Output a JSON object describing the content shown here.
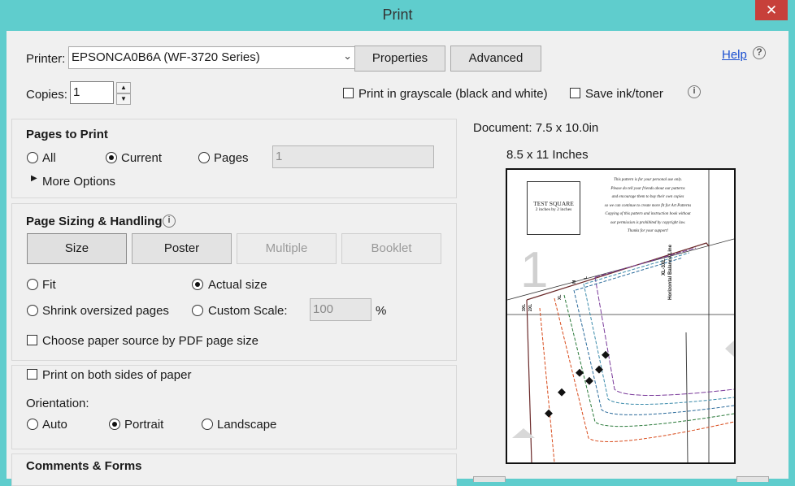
{
  "window": {
    "title": "Print",
    "close_glyph": "✕"
  },
  "printer": {
    "label": "Printer:",
    "selected": "EPSONCA0B6A (WF-3720 Series)",
    "properties_label": "Properties",
    "advanced_label": "Advanced",
    "help_label": "Help"
  },
  "copies": {
    "label": "Copies:",
    "value": "1",
    "grayscale_label": "Print in grayscale (black and white)",
    "save_ink_label": "Save ink/toner"
  },
  "pages_to_print": {
    "title": "Pages to Print",
    "all_label": "All",
    "current_label": "Current",
    "pages_label": "Pages",
    "pages_value": "1",
    "more_options_label": "More Options"
  },
  "page_sizing": {
    "title": "Page Sizing & Handling",
    "size_label": "Size",
    "poster_label": "Poster",
    "multiple_label": "Multiple",
    "booklet_label": "Booklet",
    "fit_label": "Fit",
    "actual_label": "Actual size",
    "shrink_label": "Shrink oversized pages",
    "custom_label": "Custom Scale:",
    "custom_value": "100",
    "percent": "%",
    "paper_source_label": "Choose paper source by PDF page size"
  },
  "duplex": {
    "both_sides_label": "Print on both sides of paper",
    "orientation_label": "Orientation:",
    "auto_label": "Auto",
    "portrait_label": "Portrait",
    "landscape_label": "Landscape"
  },
  "comments": {
    "title": "Comments & Forms"
  },
  "preview": {
    "document_label": "Document: 7.5 x 10.0in",
    "paper_label": "8.5 x 11 Inches",
    "test_square_title": "TEST SQUARE",
    "test_square_sub": "2 inches by 2 inches",
    "notice_lines": [
      "This pattern is for your personal use only.",
      "Please do tell your friends about our patterns",
      "and encourage them to buy their own copies",
      "so we can continue to create more fit for Art Patterns",
      "Copying of this pattern and instruction book without",
      "our permission is prohibited by copyright law.",
      "Thanks for your support!"
    ],
    "page_number": "1",
    "size_label": "XL-3XL",
    "line_label": "Horizontal Balance Line",
    "size_s": "3XL",
    "size_m": "2XL",
    "size_l": "XL",
    "size_xs": "M",
    "size_xxs": "L"
  }
}
